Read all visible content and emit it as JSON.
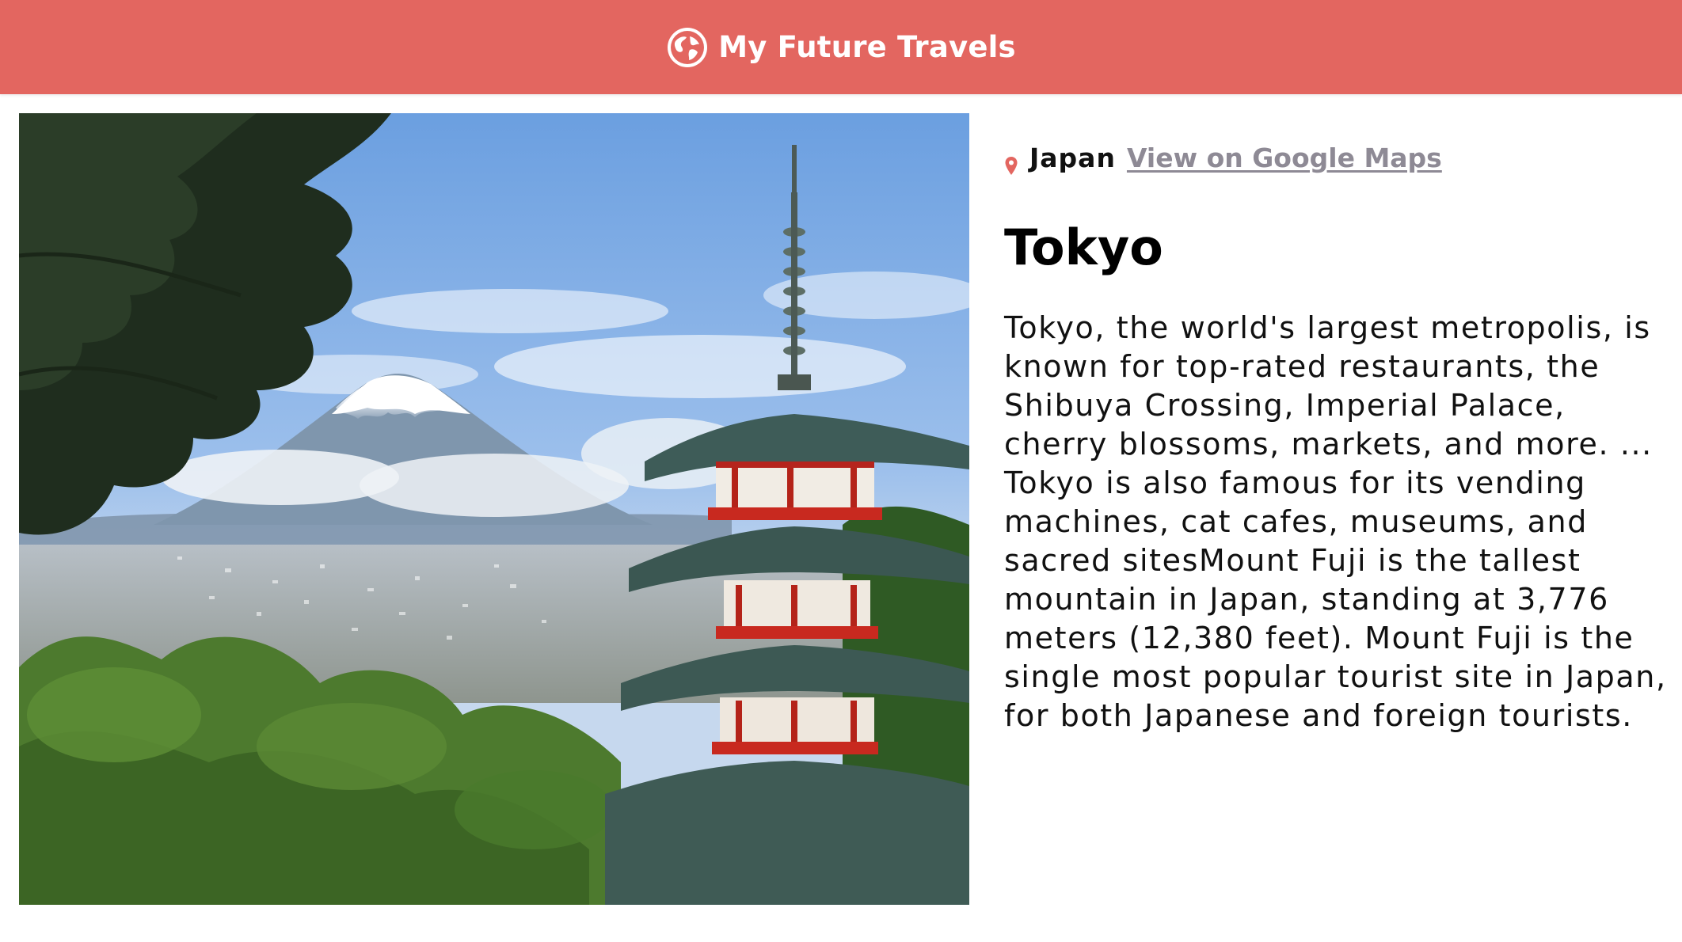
{
  "header": {
    "title": "My Future Travels",
    "icon": "globe-icon",
    "background_color": "#e36660"
  },
  "entry": {
    "photo_alt": "Chureito Pagoda with Mount Fuji",
    "country": "Japan",
    "maps_link_label": "View on Google Maps",
    "city": "Tokyo",
    "description": "Tokyo, the world's largest metropolis, is known for top-rated restaurants, the Shibuya Crossing, Imperial Palace, cherry blossoms, markets, and more. ... Tokyo is also famous for its vending machines, cat cafes, museums, and sacred sitesMount Fuji is the tallest mountain in Japan, standing at 3,776 meters (12,380 feet). Mount Fuji is the single most popular tourist site in Japan, for both Japanese and foreign tourists.",
    "pin_icon": "location-pin-icon",
    "pin_color": "#e36660",
    "link_color": "#8e8a95"
  }
}
